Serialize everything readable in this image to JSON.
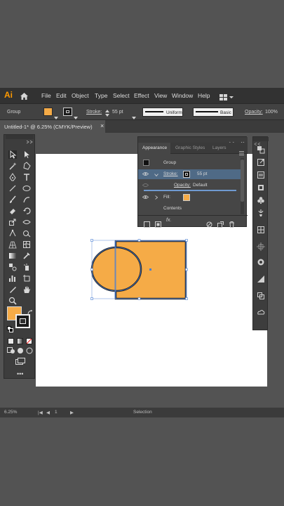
{
  "app": {
    "logo": "Ai",
    "home_icon": "home-icon"
  },
  "menu": {
    "items": [
      "File",
      "Edit",
      "Object",
      "Type",
      "Select",
      "Effect",
      "View",
      "Window",
      "Help"
    ]
  },
  "control_bar": {
    "selection_label": "Group",
    "stroke_label": "Stroke:",
    "stroke_value": "55 pt",
    "uniform_label": "Uniform",
    "basic_label": "Basic",
    "opacity_label": "Opacity:",
    "opacity_value": "100%",
    "fill_color": "#f5ab47",
    "stroke_color": "#1a1a1a"
  },
  "document": {
    "tab_title": "Untitled-1* @ 6.25% (CMYK/Preview)",
    "close_glyph": "×"
  },
  "appearance_panel": {
    "tabs": [
      "Appearance",
      "Graphic Styles",
      "Layers"
    ],
    "active_tab": 0,
    "group_label": "Group",
    "stroke_label": "Stroke:",
    "stroke_value": "55 pt",
    "opacity_label": "Opacity:",
    "opacity_value": "Default",
    "fill_label": "Fill:",
    "contents_label": "Contents",
    "fx_label": "fx."
  },
  "artwork": {
    "fill_color": "#f5ab47",
    "stroke_color": "#1a1a1a",
    "selection_color": "#4a7fd4"
  },
  "status_bar": {
    "zoom": "6.25%",
    "page": "1",
    "tool": "Selection"
  },
  "colors": {
    "accent": "#ff9a00",
    "panel_highlight": "#4f6a86"
  }
}
